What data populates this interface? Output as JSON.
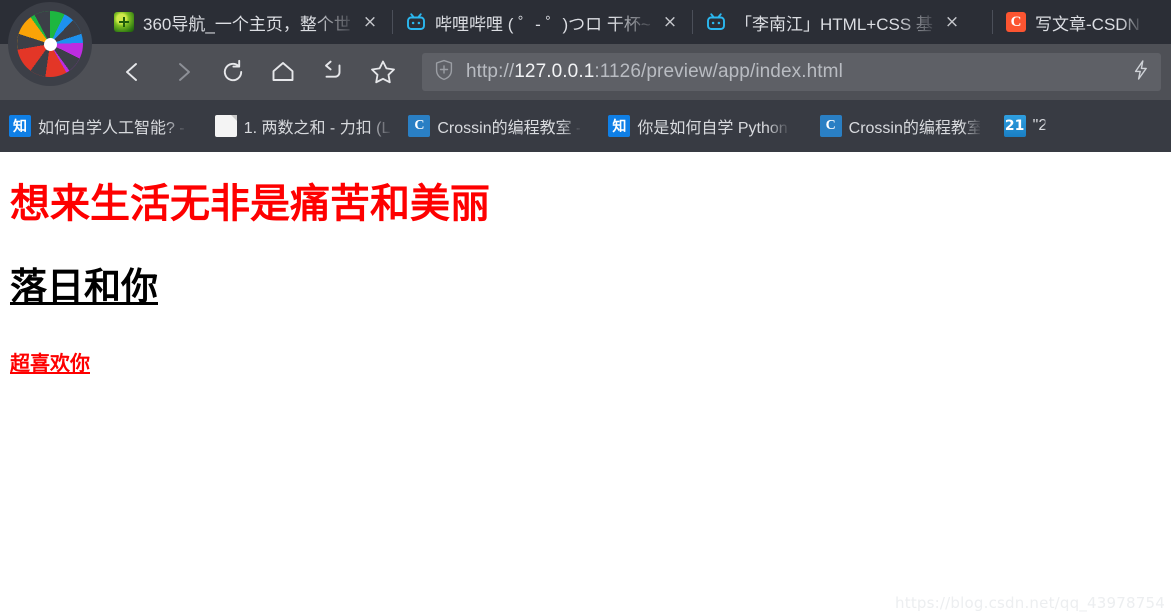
{
  "browser": {
    "logo": {
      "name": "360-browser-pinwheel-logo"
    },
    "tabs": [
      {
        "favicon": "360-nav-icon",
        "title": "360导航_一个主页，整个世",
        "close_label": "×"
      },
      {
        "favicon": "bilibili-icon",
        "title": "哔哩哔哩 ( ゜- ゜)つロ 干杯~",
        "close_label": "×"
      },
      {
        "favicon": "bilibili-icon",
        "title": "「李南江」HTML+CSS 基",
        "close_label": "×"
      },
      {
        "favicon": "csdn-icon",
        "title": "写文章-CSDN",
        "close_label": "×"
      }
    ],
    "toolbar": {
      "back_label": "back-arrow",
      "forward_label": "forward-arrow",
      "reload_label": "reload",
      "home_label": "home",
      "undo_label": "undo-arrow",
      "bookmark_star_label": "star"
    },
    "omnibox": {
      "security_icon": "shield-icon",
      "url_scheme": "http://",
      "url_host": "127.0.0.1",
      "url_rest": ":1126/preview/app/index.html",
      "bolt_icon": "lightning-bolt-icon"
    },
    "bookmarks": [
      {
        "icon": "zhihu-icon",
        "icon_text": "知",
        "label": "如何自学人工智能? -"
      },
      {
        "icon": "document-icon",
        "icon_text": "",
        "label": "1. 两数之和 - 力扣 (L"
      },
      {
        "icon": "crossin-icon",
        "icon_text": "C",
        "label": "Crossin的编程教室 -"
      },
      {
        "icon": "zhihu-icon",
        "icon_text": "知",
        "label": "你是如何自学 Python"
      },
      {
        "icon": "crossin-icon",
        "icon_text": "C",
        "label": "Crossin的编程教室"
      },
      {
        "icon": "twentyone-icon",
        "icon_text": "21",
        "label": "\"2"
      }
    ]
  },
  "page": {
    "heading": "想来生活无非是痛苦和美丽",
    "subheading": "落日和你",
    "link_text": "超喜欢你",
    "watermark": "https://blog.csdn.net/qq_43978754",
    "colors": {
      "heading_red": "#fe0000",
      "subheading_black": "#000000",
      "link_red": "#fe0000",
      "page_background": "#ffffff"
    }
  }
}
